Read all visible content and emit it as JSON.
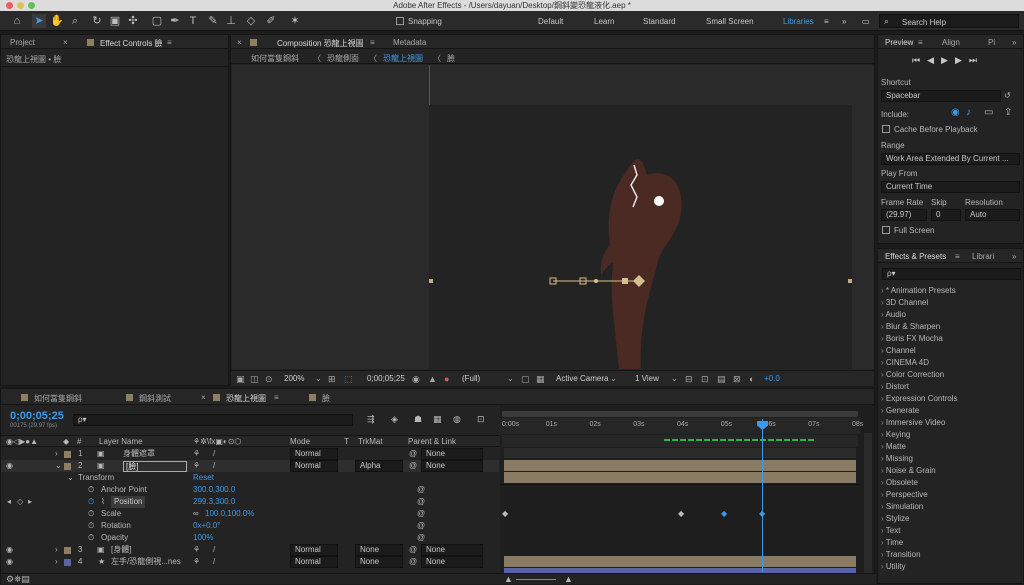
{
  "window": {
    "title": "Adobe After Effects - /Users/dayuan/Desktop/鋼斜變恐龍液化.aep *"
  },
  "toolbar": {
    "snapping_label": "Snapping",
    "workspaces": [
      "Default",
      "Learn",
      "Standard",
      "Small Screen",
      "Libraries"
    ],
    "active_workspace": "Libraries",
    "search_placeholder": "Search Help"
  },
  "left_panel": {
    "tabs": [
      "Project",
      "Effect Controls 臉"
    ],
    "subtitle": "恐龍上視圖 • 臉"
  },
  "comp_panel": {
    "tab_label": "Composition 恐龍上視圖",
    "tab_secondary": "Metadata",
    "breadcrumbs": [
      "如何當隻鋼斜",
      "恐龍側面",
      "恐龍上視圖",
      "臉"
    ],
    "footer": {
      "zoom": "200%",
      "timecode": "0;00;05;25",
      "resolution": "(Full)",
      "camera": "Active Camera",
      "view": "1 View",
      "exposure": "+0.0"
    }
  },
  "preview": {
    "tabs": [
      "Preview",
      "Align",
      "Pi"
    ],
    "shortcut_label": "Shortcut",
    "shortcut_value": "Spacebar",
    "include_label": "Include:",
    "cache_label": "Cache Before Playback",
    "range_label": "Range",
    "range_value": "Work Area Extended By Current ...",
    "playfrom_label": "Play From",
    "playfrom_value": "Current Time",
    "framerate_label": "Frame Rate",
    "skip_label": "Skip",
    "resolution_label": "Resolution",
    "framerate_value": "(29.97)",
    "skip_value": "0",
    "resolution_value": "Auto",
    "fullscreen_label": "Full Screen"
  },
  "effects": {
    "tabs": [
      "Effects & Presets",
      "Librari"
    ],
    "search_placeholder": "ρ▾",
    "items": [
      "* Animation Presets",
      "3D Channel",
      "Audio",
      "Blur & Sharpen",
      "Boris FX Mocha",
      "Channel",
      "CINEMA 4D",
      "Color Correction",
      "Distort",
      "Expression Controls",
      "Generate",
      "Immersive Video",
      "Keying",
      "Matte",
      "Missing",
      "Noise & Grain",
      "Obsolete",
      "Perspective",
      "Simulation",
      "Stylize",
      "Text",
      "Time",
      "Transition",
      "Utility"
    ]
  },
  "timeline": {
    "tabs": [
      "如何當隻鋼斜",
      "鋼斜測試",
      "恐龍上視圖",
      "臉"
    ],
    "active_tab": "恐龍上視圖",
    "timecode": "0;00;05;25",
    "frame_info": "00175 (29.97 fps)",
    "search_placeholder": "ρ▾",
    "headers": {
      "layer_name": "Layer Name",
      "mode": "Mode",
      "t": "T",
      "trkmat": "TrkMat",
      "parent": "Parent & Link",
      "num": "#"
    },
    "ruler": [
      "0:00s",
      "01s",
      "02s",
      "03s",
      "04s",
      "05s",
      "06s",
      "07s",
      "08s"
    ],
    "layers": [
      {
        "num": "1",
        "name": "身體遮罩",
        "mode": "Normal",
        "trkmat": "",
        "parent": "None",
        "color": "#8e7f60"
      },
      {
        "num": "2",
        "name": "[臉]",
        "mode": "Normal",
        "trkmat": "Alpha",
        "parent": "None",
        "color": "#8e7f60"
      },
      {
        "num": "3",
        "name": "[身體]",
        "mode": "Normal",
        "trkmat": "None",
        "parent": "None",
        "color": "#8e7f60"
      },
      {
        "num": "4",
        "name": "左手/恐龍側視...nes",
        "mode": "Normal",
        "trkmat": "None",
        "parent": "None",
        "color": "#5a63a8"
      }
    ],
    "transform": {
      "label": "Transform",
      "reset": "Reset",
      "props": [
        {
          "name": "Anchor Point",
          "value": "300.0,300.0"
        },
        {
          "name": "Position",
          "value": "299.3,300.0"
        },
        {
          "name": "Scale",
          "value": "100.0,100.0%"
        },
        {
          "name": "Rotation",
          "value": "0x+0.0°"
        },
        {
          "name": "Opacity",
          "value": "100%"
        }
      ]
    }
  }
}
